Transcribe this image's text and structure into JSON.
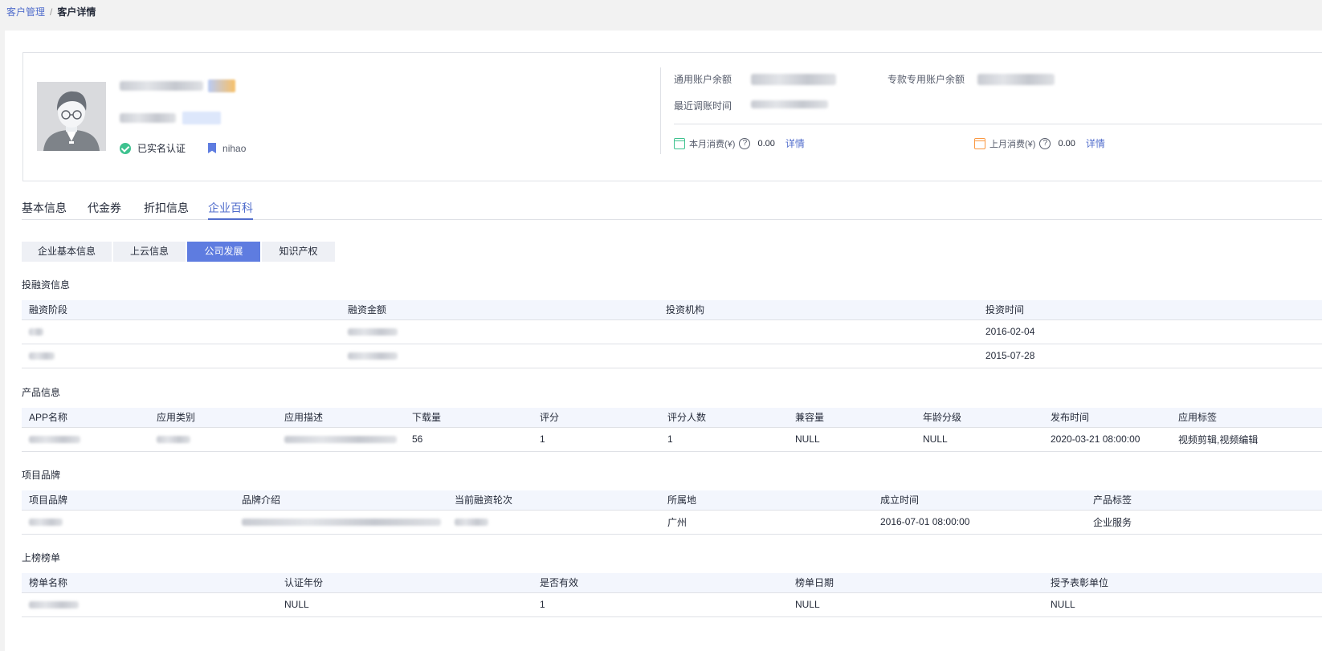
{
  "breadcrumb": {
    "parent": "客户管理",
    "separator": "/",
    "current": "客户详情"
  },
  "profile": {
    "verified_label": "已实名认证",
    "tag_label": "nihao"
  },
  "account": {
    "general_balance_label": "通用账户余额",
    "special_balance_label": "专款专用账户余额",
    "recent_time_label": "最近调账时间",
    "this_month_label": "本月消费(¥)",
    "this_month_value": "0.00",
    "last_month_label": "上月消费(¥)",
    "last_month_value": "0.00",
    "detail_link": "详情"
  },
  "tabs": [
    "基本信息",
    "代金券",
    "折扣信息",
    "企业百科"
  ],
  "segments": [
    "企业基本信息",
    "上云信息",
    "公司发展",
    "知识产权"
  ],
  "investment": {
    "title": "投融资信息",
    "columns": [
      "融资阶段",
      "融资金额",
      "投资机构",
      "投资时间"
    ],
    "rows": [
      {
        "date": "2016-02-04"
      },
      {
        "date": "2015-07-28"
      }
    ]
  },
  "products": {
    "title": "产品信息",
    "columns": [
      "APP名称",
      "应用类别",
      "应用描述",
      "下载量",
      "评分",
      "评分人数",
      "兼容量",
      "年龄分级",
      "发布时间",
      "应用标签"
    ],
    "row": {
      "downloads": "56",
      "rating": "1",
      "raters": "1",
      "compat": "NULL",
      "age": "NULL",
      "publish": "2020-03-21 08:00:00",
      "tags": "视频剪辑,视频编辑"
    }
  },
  "brands": {
    "title": "项目品牌",
    "columns": [
      "项目品牌",
      "品牌介绍",
      "当前融资轮次",
      "所属地",
      "成立时间",
      "产品标签"
    ],
    "row": {
      "location": "广州",
      "founded": "2016-07-01 08:00:00",
      "tag": "企业服务"
    }
  },
  "rankings": {
    "title": "上榜榜单",
    "columns": [
      "榜单名称",
      "认证年份",
      "是否有效",
      "榜单日期",
      "授予表彰单位"
    ],
    "row": {
      "year": "NULL",
      "valid": "1",
      "date": "NULL",
      "unit": "NULL"
    }
  }
}
